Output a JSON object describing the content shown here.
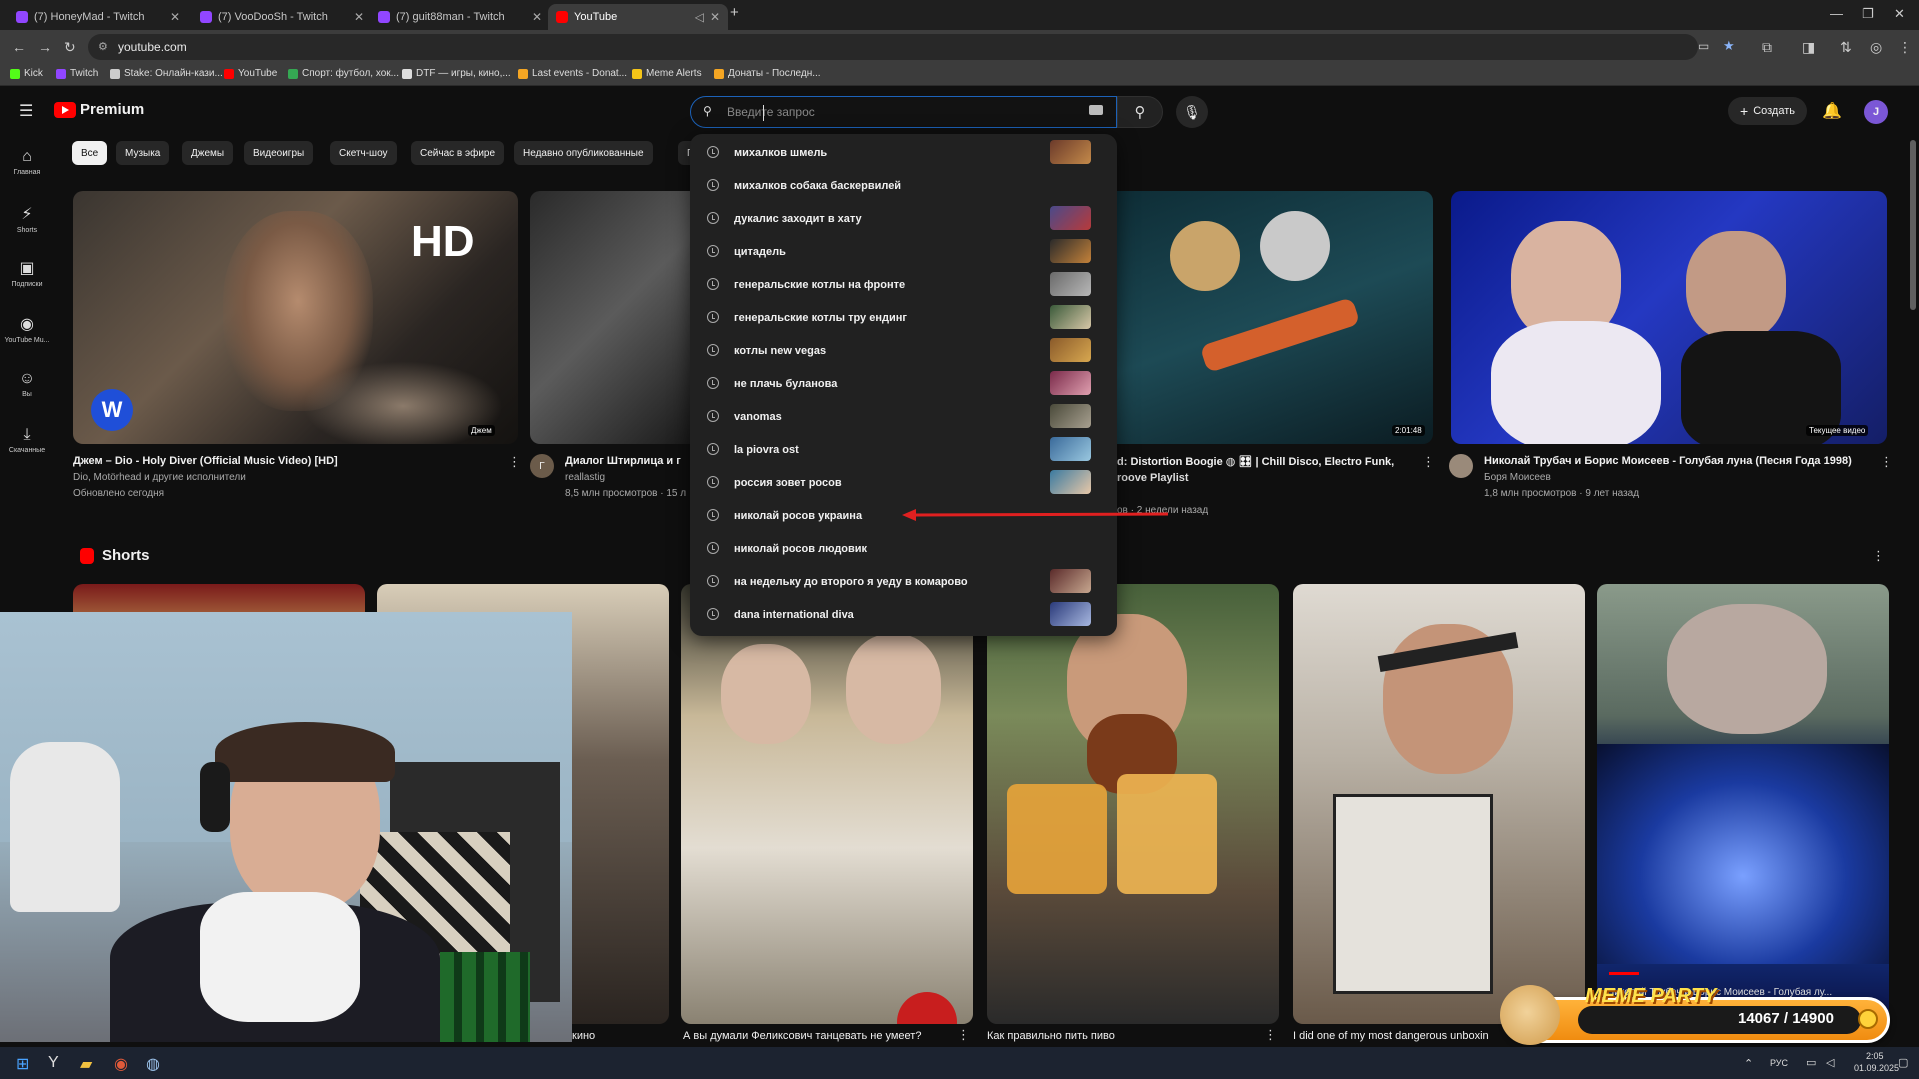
{
  "tabs": [
    {
      "title": "(7) HoneyMad - Twitch",
      "color": "#9146ff"
    },
    {
      "title": "(7) VooDooSh - Twitch",
      "color": "#9146ff"
    },
    {
      "title": "(7) guit88man - Twitch",
      "color": "#9146ff"
    },
    {
      "title": "YouTube",
      "color": "#ff0000"
    }
  ],
  "new_tab": "+",
  "address": "youtube.com",
  "bookmarks": [
    {
      "label": "Kick",
      "color": "#53fc18"
    },
    {
      "label": "Twitch",
      "color": "#9146ff"
    },
    {
      "label": "Stake: Онлайн-кази...",
      "color": "#cccccc"
    },
    {
      "label": "YouTube",
      "color": "#ff0000"
    },
    {
      "label": "Спорт: футбол, хок...",
      "color": "#35a853"
    },
    {
      "label": "DTF — игры, кино,...",
      "color": "#dddddd"
    },
    {
      "label": "Last events - Donat...",
      "color": "#f5a623"
    },
    {
      "label": "Meme Alerts",
      "color": "#f5c518"
    },
    {
      "label": "Донаты - Последн...",
      "color": "#f5a623"
    }
  ],
  "yt": {
    "logo_text": "Premium",
    "search_placeholder": "Введите запрос",
    "create_label": "Создать",
    "avatar_letter": "J"
  },
  "sidebar": [
    {
      "label": "Главная",
      "icon": "⌂"
    },
    {
      "label": "Shorts",
      "icon": "⚡"
    },
    {
      "label": "Подписки",
      "icon": "▣"
    },
    {
      "label": "YouTube Mu...",
      "icon": "◉"
    },
    {
      "label": "Вы",
      "icon": "☺"
    },
    {
      "label": "Скачанные",
      "icon": "⤓"
    }
  ],
  "chips": [
    "Все",
    "Музыка",
    "Джемы",
    "Видеоигры",
    "Скетч-шоу",
    "Сейчас в эфире",
    "Недавно опубликованные",
    "Пр"
  ],
  "suggestions": [
    "михалков шмель",
    "михалков собака баскервилей",
    "дукалис заходит в хату",
    "цитадель",
    "генеральские котлы на фронте",
    "генеральские котлы тру ендинг",
    "котлы new vegas",
    "не плачь буланова",
    "vanomas",
    "la piovra ost",
    "россия зовет росов",
    "николай росов украина",
    "николай росов людовик",
    "на недельку до второго я уеду в комарово",
    "dana international diva"
  ],
  "videos": [
    {
      "title": "Джем – Dio - Holy Diver (Official Music Video) [HD]",
      "meta1": "Dio, Motörhead и другие исполнители",
      "meta2": "Обновлено сегодня",
      "badge": "Джем",
      "hd": "HD"
    },
    {
      "title": "Диалог Штирлица и г",
      "meta1": "reallastig",
      "meta2": "8,5 млн просмотров · 15 л",
      "avatar_letter": "Г"
    },
    {
      "title": "d: Distortion Boogie ◍ 🎛 | Chill Disco, Electro Funk,",
      "meta1": "roove Playlist",
      "meta2": "ов · 2 недели назад",
      "duration": "2:01:48"
    },
    {
      "title": "Николай Трубач и Борис Моисеев - Голубая луна (Песня Года 1998)",
      "meta1": "Боря Моисеев",
      "meta2": "1,8 млн просмотров · 9 лет назад",
      "badge": "Текущее видео"
    }
  ],
  "shorts_label": "Shorts",
  "shorts": [
    {
      "title": "кино"
    },
    {
      "title": "А вы думали Феликсович танцевать не умеет?"
    },
    {
      "title": "Как правильно пить пиво"
    },
    {
      "title": "I did one of my most dangerous unboxin"
    },
    {
      "title": "Николай Трубач и Борис Моисеев - Голубая лу..."
    }
  ],
  "meme": {
    "title": "MEME PARTY",
    "progress": "14067 / 14900",
    "progress_value": 14067,
    "progress_max": 14900
  },
  "taskbar": {
    "lang": "РУС",
    "time": "2:05",
    "date": "01.09.2025"
  },
  "colors": {
    "accent": "#1c62b9",
    "brand": "#ff0000",
    "annotation_arrow": "#e02020"
  }
}
